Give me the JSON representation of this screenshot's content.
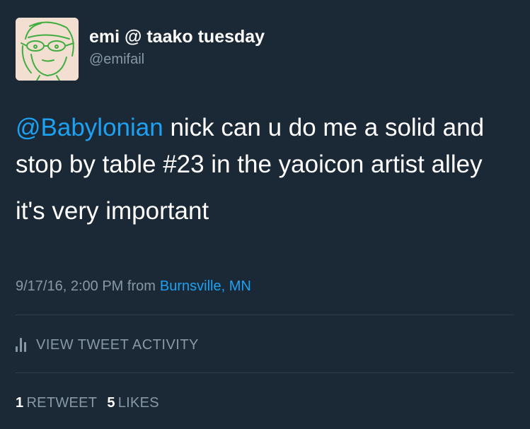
{
  "author": {
    "display_name": "emi @ taako tuesday",
    "handle": "@emifail",
    "avatar_icon": "doodle-face-avatar"
  },
  "tweet": {
    "mention": "@Babylonian",
    "line1_rest": " nick can u do me a solid and stop by table #23 in the yaoicon artist alley",
    "line2": "it's very important"
  },
  "meta": {
    "timestamp": "9/17/16, 2:00 PM from",
    "location": "Burnsville, MN"
  },
  "activity": {
    "icon": "bar-chart-icon",
    "label": "VIEW TWEET ACTIVITY"
  },
  "stats": {
    "retweet_count": "1",
    "retweet_label": "RETWEET",
    "likes_count": "5",
    "likes_label": "LIKES"
  },
  "colors": {
    "background": "#1b2836",
    "link": "#1da1f2",
    "secondary_text": "#8899a6",
    "primary_text": "#ffffff"
  }
}
